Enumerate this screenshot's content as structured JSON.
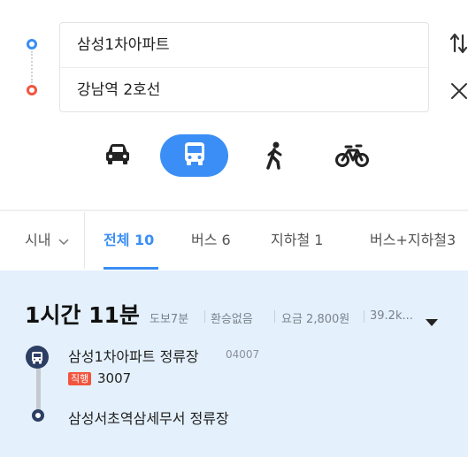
{
  "route": {
    "start": "삼성1차아파트",
    "end": "강남역 2호선"
  },
  "modes": [
    {
      "name": "car",
      "icon": "car-icon",
      "active": false
    },
    {
      "name": "transit",
      "icon": "bus-icon",
      "active": true
    },
    {
      "name": "walk",
      "icon": "walk-icon",
      "active": false
    },
    {
      "name": "bike",
      "icon": "bike-icon",
      "active": false
    }
  ],
  "tabs": {
    "city": "시내",
    "all": "전체",
    "all_count": "10",
    "bus": "버스",
    "bus_count": "6",
    "subway": "지하철",
    "subway_count": "1",
    "bus_subway": "버스+지하철",
    "bus_subway_count": "3"
  },
  "result": {
    "duration": "1시간 11분",
    "walk": "도보7분",
    "transfer": "환승없음",
    "fare": "요금 2,800원",
    "distance": "39.2k..."
  },
  "stops": {
    "board_name": "삼성1차아파트 정류장",
    "board_id": "04007",
    "bus_type": "직행",
    "bus_number": "3007",
    "alight_name": "삼성서초역삼세무서 정류장"
  },
  "colors": {
    "accent": "#3a8ef6",
    "start": "#3a8ef6",
    "end": "#f2553e",
    "result_bg": "#e4f0fb",
    "route_line": "#2c3e63"
  }
}
